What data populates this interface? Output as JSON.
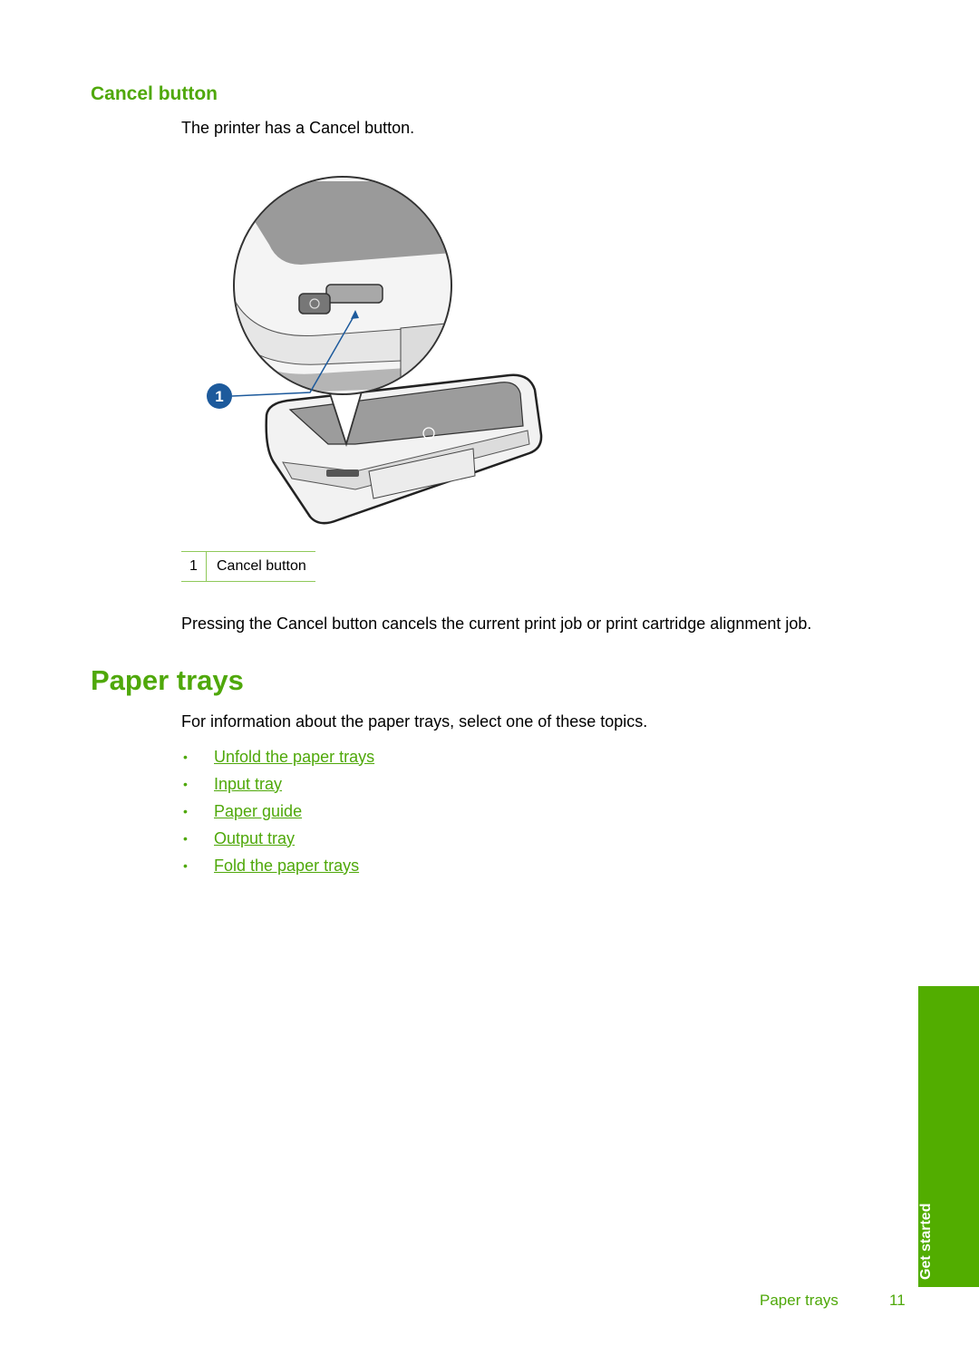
{
  "section": {
    "heading": "Cancel button",
    "intro": "The printer has a Cancel button.",
    "figure": {
      "alt": "Printer with magnified Cancel button",
      "callout_marker": "1"
    },
    "callout_table": {
      "number": "1",
      "label": "Cancel button"
    },
    "description": "Pressing the Cancel button cancels the current print job or print cartridge alignment job."
  },
  "paper_trays": {
    "heading": "Paper trays",
    "intro": "For information about the paper trays, select one of these topics.",
    "bullet": "•",
    "links": [
      {
        "label": "Unfold the paper trays"
      },
      {
        "label": "Input tray"
      },
      {
        "label": "Paper guide"
      },
      {
        "label": "Output tray"
      },
      {
        "label": "Fold the paper trays"
      }
    ]
  },
  "side_tab": {
    "label": "Get started",
    "color": "#52ad00"
  },
  "footer": {
    "title": "Paper trays",
    "page": "11"
  },
  "colors": {
    "accent": "#4fa80a",
    "callout_blue": "#1d5a9c"
  }
}
